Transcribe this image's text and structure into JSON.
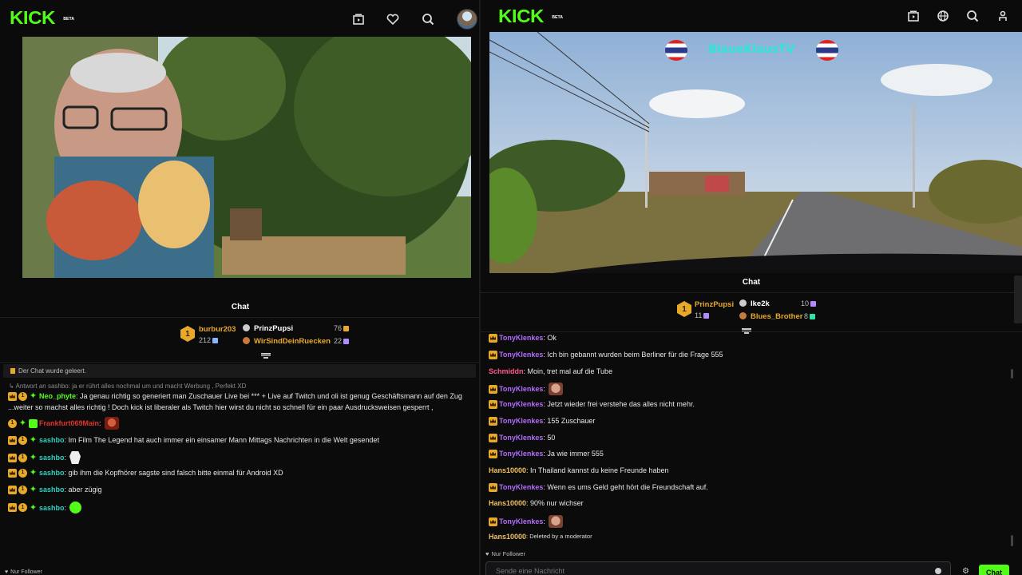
{
  "colors": {
    "brand": "#53fc18",
    "crown": "#e8a92a",
    "bg": "#0b0b0c"
  },
  "left": {
    "logo": "KICK",
    "logo_beta": "BETA",
    "icons": [
      "clips-icon",
      "heart-icon",
      "search-icon",
      "avatar"
    ],
    "chat_title": "Chat",
    "leaderboard": {
      "first": {
        "rank": "1",
        "name": "burbur203",
        "count": "212"
      },
      "second": {
        "name": "PrinzPupsi",
        "count": "76"
      },
      "third": {
        "name": "WirSindDeinRuecken",
        "count": "22"
      }
    },
    "system_message": "Der Chat wurde geleert.",
    "reply_preview": "Antwort an sashbo: ja er rührt alles nochmal um und macht Werbung , Perfekt XD",
    "messages": [
      {
        "user": "Neo_phyte",
        "text": ": Ja genau richtig so generiert man Zuschauer Live bei *** + Live auf Twitch und oli ist genug Geschäftsmann auf den Zug",
        "text2": "...weiter so machst alles richtig ! Doch kick ist liberaler als Twitch hier wirst du nicht so schnell für ein paar Ausdrucksweisen gesperrt ,"
      },
      {
        "user": "Frankfurt069Main",
        "text": ":"
      },
      {
        "user": "sashbo",
        "text": ": Im Film The Legend hat auch immer ein einsamer Mann Mittags Nachrichten in die Welt gesendet"
      },
      {
        "user": "sashbo",
        "text": ":"
      },
      {
        "user": "sashbo",
        "text": ": gib ihm die Kopfhörer sagste sind falsch bitte einmal für Android XD"
      },
      {
        "user": "sashbo",
        "text": ": aber zügig"
      },
      {
        "user": "sashbo",
        "text": ":"
      }
    ],
    "follower_mode": "Nur Follower"
  },
  "right": {
    "logo": "KICK",
    "logo_beta": "BETA",
    "overlay_title": "BlaueKlausTV",
    "chat_title": "Chat",
    "leaderboard": {
      "first": {
        "rank": "1",
        "name": "PrinzPupsi",
        "count": "11"
      },
      "second": {
        "name": "Ike2k",
        "count": "10"
      },
      "third": {
        "name": "Blues_Brother",
        "count": "8"
      }
    },
    "messages": [
      {
        "user": "TonyKlenkes",
        "text": ": Ok"
      },
      {
        "user": "TonyKlenkes",
        "text": ": Ich bin gebannt wurden beim Berliner für die Frage 555"
      },
      {
        "user": "Schmiddn",
        "text": ": Moin, tret mal auf die Tube"
      },
      {
        "user": "TonyKlenkes",
        "text": ":"
      },
      {
        "user": "TonyKlenkes",
        "text": ": Jetzt wieder frei verstehe das alles nicht mehr."
      },
      {
        "user": "TonyKlenkes",
        "text": ": 155 Zuschauer"
      },
      {
        "user": "TonyKlenkes",
        "text": ": 50"
      },
      {
        "user": "TonyKlenkes",
        "text": ": Ja wie immer 555"
      },
      {
        "user": "Hans10000",
        "text": ": In Thailand kannst du keine Freunde haben"
      },
      {
        "user": "TonyKlenkes",
        "text": ": Wenn es ums Geld geht hört die Freundschaft auf."
      },
      {
        "user": "Hans10000",
        "text": ": 90% nur wichser"
      },
      {
        "user": "TonyKlenkes",
        "text": ":"
      },
      {
        "user": "Hans10000",
        "text": ": Deleted by a moderator"
      }
    ],
    "follower_mode": "Nur Follower",
    "input_placeholder": "Sende eine Nachricht",
    "send_label": "Chat"
  }
}
